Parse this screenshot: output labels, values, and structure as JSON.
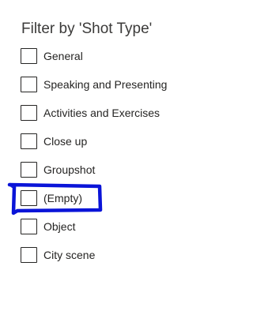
{
  "filter": {
    "title": "Filter by 'Shot Type'",
    "options": [
      {
        "label": "General",
        "checked": false
      },
      {
        "label": "Speaking and Presenting",
        "checked": false
      },
      {
        "label": "Activities and Exercises",
        "checked": false
      },
      {
        "label": "Close up",
        "checked": false
      },
      {
        "label": "Groupshot",
        "checked": false
      },
      {
        "label": "(Empty)",
        "checked": false
      },
      {
        "label": "Object",
        "checked": false
      },
      {
        "label": "City scene",
        "checked": false
      }
    ]
  },
  "annotation": {
    "highlighted_option": "(Empty)",
    "color": "#0a14d8"
  }
}
